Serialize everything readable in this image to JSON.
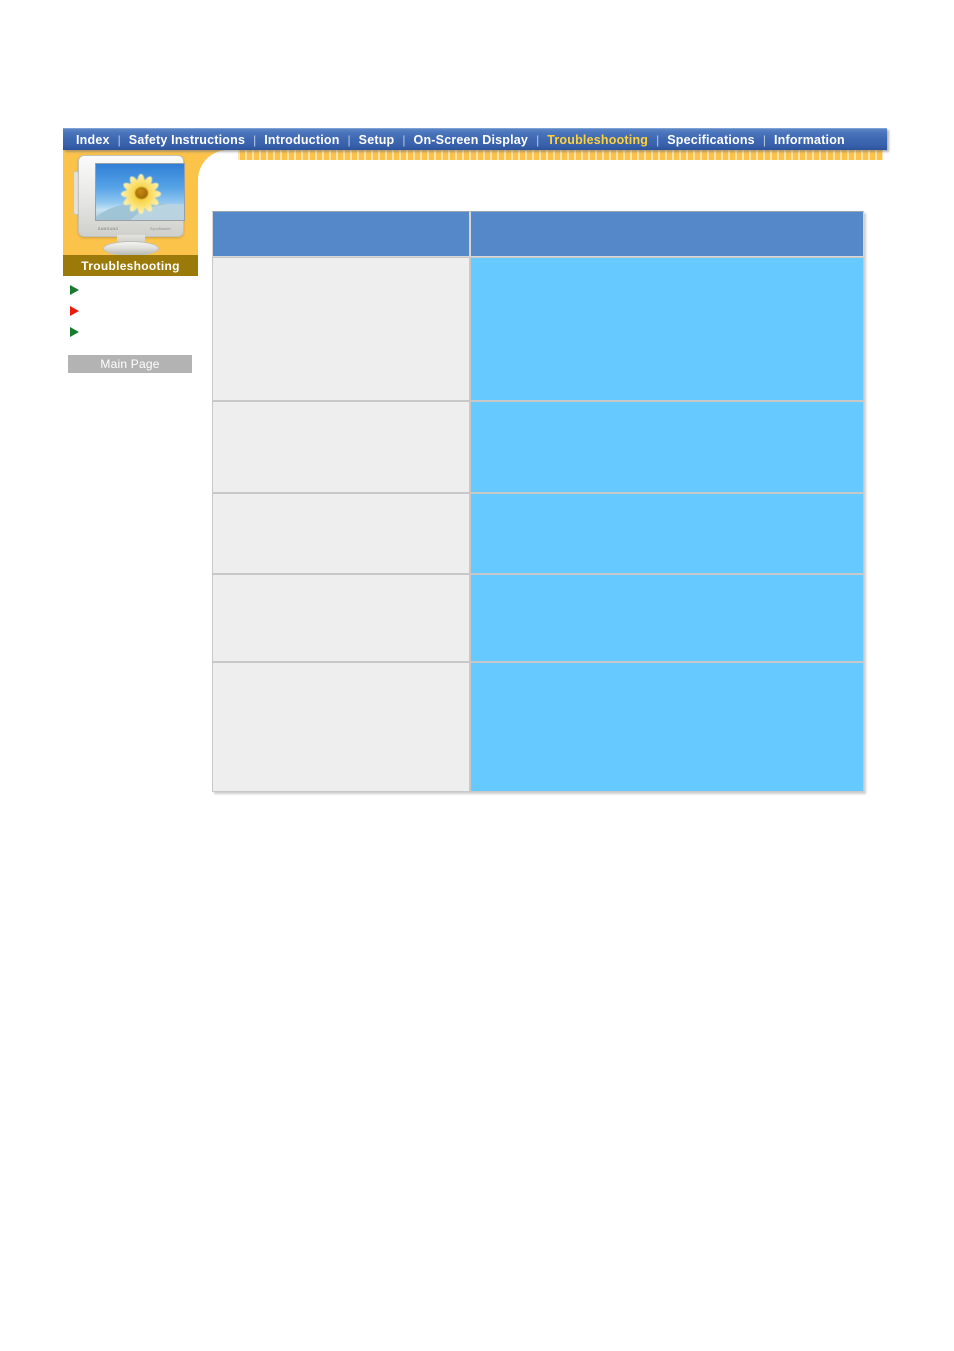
{
  "nav": {
    "items": [
      {
        "label": "Index",
        "active": false
      },
      {
        "label": "Safety Instructions",
        "active": false
      },
      {
        "label": "Introduction",
        "active": false
      },
      {
        "label": "Setup",
        "active": false
      },
      {
        "label": "On-Screen Display",
        "active": false
      },
      {
        "label": "Troubleshooting",
        "active": true
      },
      {
        "label": "Specifications",
        "active": false
      },
      {
        "label": "Information",
        "active": false
      }
    ],
    "separator": "|",
    "text_color": "#ffffff",
    "active_color": "#ffd23a",
    "bar_color": "#3e67b2",
    "underline_color": "#fbc34a"
  },
  "sidebar": {
    "panel_color": "#fbc34a",
    "section_band": {
      "label": "Troubleshooting",
      "background": "#9b7a09",
      "text_color": "#ffffff"
    },
    "monitor": {
      "icon": "crt-monitor-icon",
      "brand": "SAMSUNG",
      "model": "SyncMaster",
      "screen_image": "sunflower-wallpaper"
    },
    "links": [
      {
        "label": "",
        "marker": "green-triangle-icon",
        "marker_color": "#1a7a2e"
      },
      {
        "label": "",
        "marker": "red-triangle-icon",
        "marker_color": "#e81c0c"
      },
      {
        "label": "",
        "marker": "green-triangle-icon",
        "marker_color": "#1a7a2e"
      }
    ],
    "main_page_button": {
      "label": "Main Page",
      "background": "#b3b3b3",
      "text_color": "#ffffff"
    }
  },
  "table": {
    "header_color": "#5588c8",
    "symptom_cell_color": "#eeeeee",
    "solution_cell_color": "#66c9ff",
    "columns": [
      "",
      ""
    ],
    "rows": [
      {
        "symptom": "",
        "solution": ""
      },
      {
        "symptom": "",
        "solution": ""
      },
      {
        "symptom": "",
        "solution": ""
      },
      {
        "symptom": "",
        "solution": ""
      },
      {
        "symptom": "",
        "solution": ""
      }
    ]
  }
}
